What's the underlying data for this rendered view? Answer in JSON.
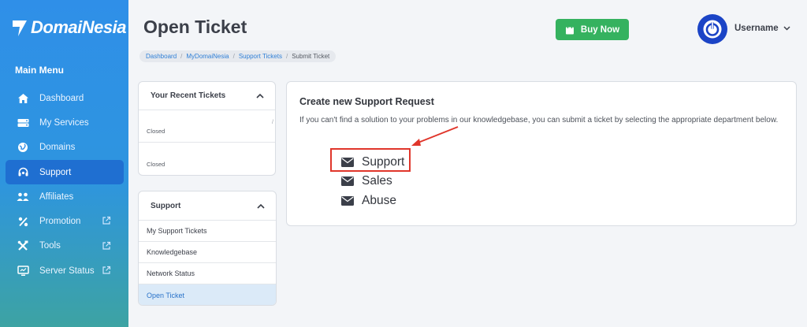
{
  "brand": {
    "name": "DomaiNesia"
  },
  "sidebar": {
    "menu_title": "Main Menu",
    "items": [
      {
        "label": "Dashboard",
        "icon": "home-icon",
        "external": false,
        "active": false
      },
      {
        "label": "My Services",
        "icon": "server-icon",
        "external": false,
        "active": false
      },
      {
        "label": "Domains",
        "icon": "globe-icon",
        "external": false,
        "active": false
      },
      {
        "label": "Support",
        "icon": "headset-icon",
        "external": false,
        "active": true
      },
      {
        "label": "Affiliates",
        "icon": "users-icon",
        "external": false,
        "active": false
      },
      {
        "label": "Promotion",
        "icon": "percent-icon",
        "external": true,
        "active": false
      },
      {
        "label": "Tools",
        "icon": "tools-icon",
        "external": true,
        "active": false
      },
      {
        "label": "Server Status",
        "icon": "monitor-icon",
        "external": true,
        "active": false
      }
    ]
  },
  "header": {
    "title": "Open Ticket",
    "buy_label": "Buy Now",
    "username": "Username",
    "breadcrumb": [
      "Dashboard",
      "MyDomaiNesia",
      "Support Tickets",
      "Submit Ticket"
    ]
  },
  "recent_tickets": {
    "title": "Your Recent Tickets",
    "tickets": [
      {
        "status": "Closed"
      },
      {
        "status": "Closed"
      }
    ]
  },
  "support_panel": {
    "title": "Support",
    "links": [
      "My Support Tickets",
      "Knowledgebase",
      "Network Status",
      "Open Ticket"
    ],
    "active_link": "Open Ticket"
  },
  "main": {
    "title": "Create new Support Request",
    "description": "If you can't find a solution to your problems in our knowledgebase, you can submit a ticket by selecting the appropriate department below.",
    "departments": [
      "Support",
      "Sales",
      "Abuse"
    ],
    "highlighted_department": "Support"
  },
  "colors": {
    "accent": "#2f8fe8",
    "buy_button": "#35b25f",
    "highlight": "#e0362b",
    "avatar": "#1b44c6"
  }
}
